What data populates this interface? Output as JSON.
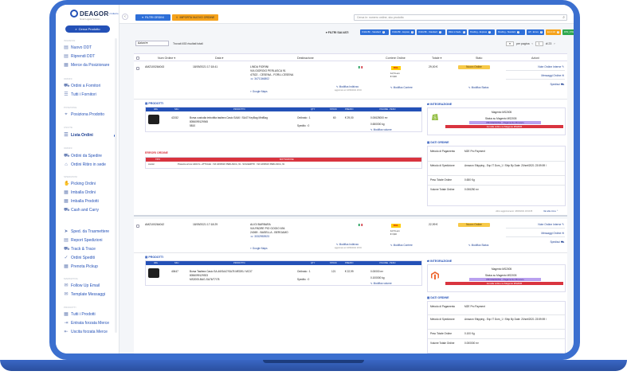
{
  "app": {
    "logo": "DEAGOR",
    "logo_sub": "Smart Logistic Solution",
    "back_label": "« Indietro"
  },
  "sidebar": {
    "search_button": "Cerca Prodotto",
    "sections": {
      "s1": "Ingressi",
      "s2": "Ordini",
      "s3": "Posizione",
      "s4": "Uscite",
      "s5": "Ordini",
      "s6": "Spedizioni",
      "s7": "Marketing",
      "s8": "Prodotti"
    },
    "items": [
      {
        "label": "Nuovo DDT"
      },
      {
        "label": "Riprendi DDT"
      },
      {
        "label": "Merce da Posizionare"
      },
      {
        "label": "Ordini a Fornitori"
      },
      {
        "label": "Tutti i Fornitori"
      },
      {
        "label": "Posiziona Prodotto"
      },
      {
        "label": "Lista Ordini"
      },
      {
        "label": "Ordini da Spedire"
      },
      {
        "label": "Ordini Ritiro in sede"
      },
      {
        "label": "Picking Ordini"
      },
      {
        "label": "Imballa Ordini"
      },
      {
        "label": "Imballa Prodotti"
      },
      {
        "label": "Cash and Carry"
      },
      {
        "label": "Sped. da Trasmettere"
      },
      {
        "label": "Report Spedizioni"
      },
      {
        "label": "Track & Trace"
      },
      {
        "label": "Ordini Spediti"
      },
      {
        "label": "Prenota Pickup"
      },
      {
        "label": "Follow Up Email"
      },
      {
        "label": "Template Messaggi"
      },
      {
        "label": "Tutti i Prodotti"
      },
      {
        "label": "Entrata forzata Merce"
      },
      {
        "label": "Uscita forzata Merce"
      }
    ]
  },
  "header": {
    "filter_button": "FILTRI ORDINI",
    "import_button": "IMPORTA NUOVO ORDINE",
    "search_placeholder": "Cerca in: numero ordine, sku prodotto"
  },
  "saved_filters": {
    "label": "FILTRI SALVATI",
    "chips": [
      {
        "label": "Ordini BF - Standard",
        "color": "#2e6fd8"
      },
      {
        "label": "Ordini BF - Express",
        "color": "#2e6fd8"
      },
      {
        "label": "Ordini BF - Standard",
        "color": "#2e6fd8"
      },
      {
        "label": "Ritiro in Sede",
        "color": "#2e6fd8"
      },
      {
        "label": "Pending - Express",
        "color": "#2e6fd8"
      },
      {
        "label": "Pending - Standard",
        "color": "#2e6fd8"
      },
      {
        "label": "AP - Errore",
        "color": "#2e6fd8"
      },
      {
        "label": "Errori AP",
        "color": "#f5a21b"
      },
      {
        "label": "DTR_STANDARD",
        "color": "#2fa84f"
      }
    ]
  },
  "toolbar": {
    "actions_select": "Azioni",
    "found_text": "Trovati 453 risultati totali",
    "per_page": "per pagina",
    "page_current": "1",
    "page_total": "di 23"
  },
  "table": {
    "headers": {
      "num": "Num Ordine ▾",
      "data": "Data ▾",
      "dest": "Destinazione",
      "corriere": "Corriere Ordine",
      "totale": "Totale ▾",
      "stato": "Stato",
      "azioni": "Azioni"
    }
  },
  "orders": [
    {
      "num": "AMZ100264043",
      "date": "18/09/2021 17:18:41",
      "dest_name": "LINDA FIORINI",
      "dest_street": "VIA GIORGIO PERLASCA 91",
      "dest_city": "47522 - CESENA - FORLI-CESENA",
      "dest_phone": "3471346802",
      "maps": "Google Maps",
      "carrier": "DHL",
      "weight": "12,5 Lum",
      "price": "€ 3,90",
      "total": "29,00 €",
      "status": "Nuovo Ordine",
      "modifica_indirizzo": "Modifica Indirizzo",
      "aggiornato": "aggiornato al: 18/09/2021 18:04",
      "modifica_corriere": "Modifica Corriere",
      "modifica_stato": "Modifica Status",
      "note": "Note Ordine Interne",
      "messaggi": "Messaggi Ordine",
      "spedisci": "Spedisci",
      "prodotti_title": "PRODOTTI",
      "prod_headers": [
        "IMG",
        "SKU",
        "PRODOTTO",
        "QTY",
        "STOCK",
        "PREZZO",
        "VOLUME - PESO"
      ],
      "prod_sku": "42152",
      "prod_name": "Borsa custodia imbottita tastiera Casio SA46 / SA47 KeyBag MiniBag",
      "prod_ean": "8056099129945",
      "prod_extra": "5810",
      "prod_ordered": "Ordinato : 1",
      "prod_shipped": "Spedito : 0",
      "prod_stock": "60",
      "prod_price": "€ 29,00",
      "prod_volume": "0.00625000 m³",
      "prod_weight": "0.650000 kg",
      "modifica_volume": "Modifica volume",
      "errori_title": "ERRORI ORDINE",
      "err_headers": [
        "TIPO",
        "MOTIVAZIONE"
      ],
      "err_type": "courier",
      "err_msg": "Presente errore indirizzo - ATTUALE : VIA GIORGIO PERLASCA, 91 - SUGGERITO : VIA GIORGIO PERLASCA, 91",
      "integr_title": "INTEGRAZIONE",
      "integr_store": "Magento MS2005",
      "integr_status": "Status su Magento MS2005",
      "integr_state": "PROCESSING - Pagamento Ricevuto",
      "integr_cancel": "Annulla ordine su Magento MS2005",
      "dati_title": "DATI ORDINE",
      "metodo_pag_label": "Metodo di Pagamento",
      "metodo_pag": "M2E Pro Payment",
      "metodo_sped_label": "Metodo di Spedizione",
      "metodo_sped": "Amazon Shipping - Exp IT Dom_1 / Ship By Date: 20/set/2021 23:59:59 /",
      "peso_label": "Peso Totale Ordine",
      "peso": "0.650 Kg",
      "volume_label": "Volume Totale Ordine",
      "volume": "0.006250 m³",
      "footer_note": "ultimo aggiornamento: 18/09/2021 18:04:05",
      "footer_link": "Vai alla cima"
    },
    {
      "num": "AMZ100264042",
      "date": "18/09/2021 17:18:29",
      "dest_name": "ALIGI BARBARA",
      "dest_street": "VIA PADRE PIO GOGIO 694",
      "dest_city": "24069 - BASELLA - BERGAMO",
      "dest_phone": "3332953923",
      "maps": "Google Maps",
      "carrier": "DHL",
      "weight": "12,5 Lum",
      "price": "€ 3,90",
      "total": "22,99 €",
      "status": "Nuovo Ordine",
      "modifica_indirizzo": "Modifica Indirizzo",
      "aggiornato": "aggiornato al: 18/09/2021 18:04",
      "modifica_corriere": "Modifica Corriere",
      "modifica_stato": "Modifica Status",
      "note": "Note Ordine Interne",
      "messaggi": "Messaggi Ordine",
      "spedisci": "Spedisci",
      "prodotti_title": "PRODOTTI",
      "prod_headers": [
        "IMG",
        "SKU",
        "PRODOTTO",
        "QTY",
        "STOCK",
        "PREZZO",
        "VOLUME - PESO"
      ],
      "prod_sku": "40647",
      "prod_name": "Borsa Tastiera Casio SA-46/SA47/SA78 MEDEL! MC37",
      "prod_ean": "8056099129923",
      "prod_extra": "MS2005-BAG-SA76/77/78",
      "prod_ordered": "Ordinato : 1",
      "prod_shipped": "Spedito : 0",
      "prod_stock": "121",
      "prod_price": "€ 22,99",
      "prod_volume": "0.00000 m³",
      "prod_weight": "0.100000 kg",
      "modifica_volume": "Modifica volume",
      "integr_title": "INTEGRAZIONE",
      "integr_store": "Magento MS2005",
      "integr_status": "Status su Magento MS2005",
      "integr_state": "PROCESSING - Pagamento Ricevuto",
      "integr_cancel": "Annulla ordine su Magento MS2005",
      "dati_title": "DATI ORDINE",
      "metodo_pag_label": "Metodo di Pagamento",
      "metodo_pag": "M2E Pro Payment",
      "metodo_sped_label": "Metodo di Spedizione",
      "metodo_sped": "Amazon Shipping - Exp IT Dom_1 / Ship By Date: 20/set/2021 23:59:59 /",
      "peso_label": "Peso Totale Ordine",
      "peso": "0.100 Kg",
      "volume_label": "Volume Totale Ordine",
      "volume": "0.000000 m³"
    }
  ]
}
